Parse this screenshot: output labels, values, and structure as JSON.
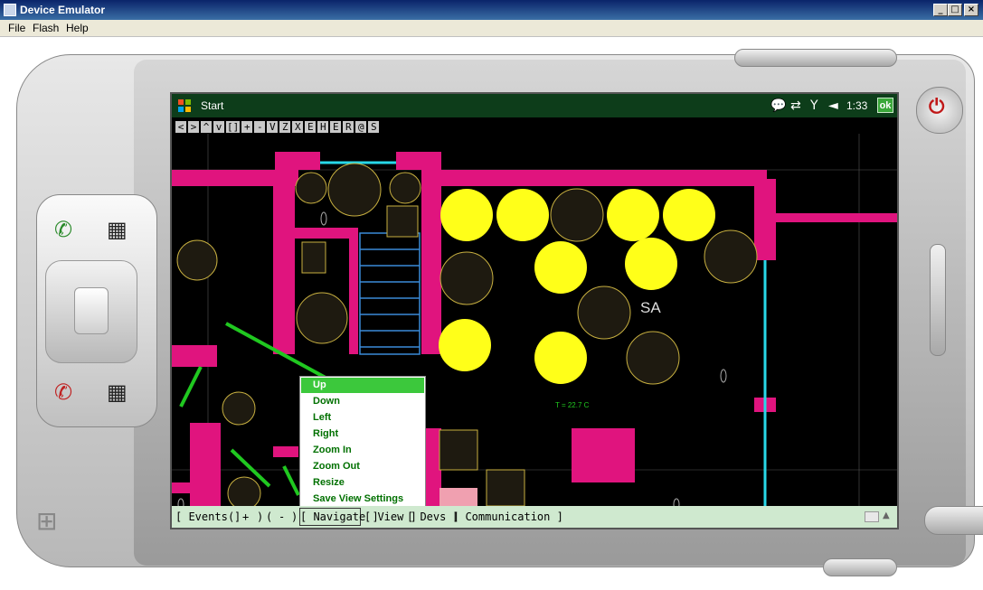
{
  "window": {
    "title": "Device Emulator",
    "min": "_",
    "max": "□",
    "close": "×"
  },
  "menubar": {
    "items": [
      "File",
      "Flash",
      "Help"
    ]
  },
  "device": {
    "start_label": "Start",
    "clock": "1:33",
    "ok_label": "ok",
    "tray_icons": [
      "chat-icon",
      "sync-icon",
      "no-signal-icon",
      "volume-mute-icon"
    ],
    "toolbar_buttons": [
      "<",
      ">",
      "^",
      "v",
      "[]",
      "+",
      "-",
      "V",
      "Z",
      "X",
      "E",
      "H",
      "E",
      "R",
      "@",
      "S"
    ],
    "plan": {
      "room_label": "SA",
      "temp_label": "T = 22.7 C",
      "colors": {
        "wall": "#e0147e",
        "lamp_on": "#ffff19",
        "lamp_off": "#1e1a10",
        "outline": "#c8b040",
        "pipe": "#28d8e8",
        "stairs": "#3a8bd8",
        "sensor": "#20c820"
      }
    },
    "context_menu": {
      "selected": "Up",
      "items": [
        "Up",
        "Down",
        "Left",
        "Right",
        "Zoom In",
        "Zoom Out",
        "Resize",
        "Save View Settings"
      ]
    },
    "bottom_bar": {
      "events": "[ Events ]",
      "open_paren": "(",
      "plus": "+",
      "close_paren": ")",
      "open_paren2": "(",
      "minus": "-",
      "close_paren2": ")",
      "navigate": "[ Navigate ]",
      "view": "[ View ]",
      "devs": "[ Devs ]",
      "communication": "[ Communication ]"
    }
  },
  "hardware": {
    "call_icon": "call-icon",
    "end_icon": "end-call-icon",
    "power_icon": "power-icon",
    "windows_icon": "windows-logo-icon"
  }
}
